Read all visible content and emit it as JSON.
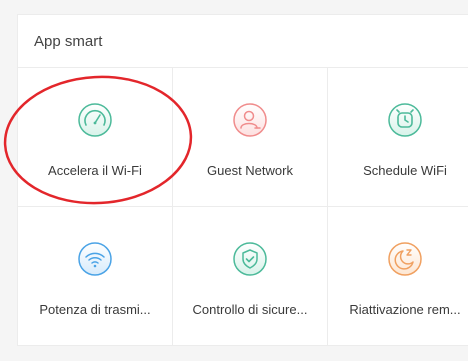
{
  "section": {
    "title": "App smart"
  },
  "tiles": [
    {
      "label": "Accelera il Wi-Fi",
      "icon": "speedometer-icon",
      "color": "#4cba9a"
    },
    {
      "label": "Guest Network",
      "icon": "guest-user-icon",
      "color": "#f08c8c"
    },
    {
      "label": "Schedule WiFi",
      "icon": "alarm-clock-icon",
      "color": "#4cba9a"
    },
    {
      "label": "Potenza di trasmi...",
      "icon": "wifi-signal-icon",
      "color": "#4aa3e6"
    },
    {
      "label": "Controllo di sicure...",
      "icon": "shield-check-icon",
      "color": "#4cba9a"
    },
    {
      "label": "Riattivazione rem...",
      "icon": "sleep-moon-icon",
      "color": "#f0a060"
    }
  ],
  "annotation": {
    "color": "#e3262b"
  }
}
